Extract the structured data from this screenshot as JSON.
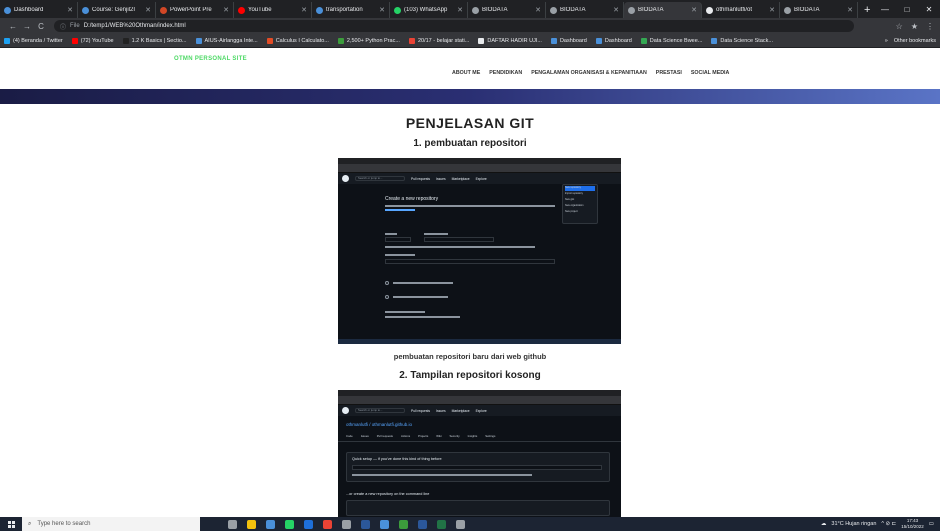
{
  "browser": {
    "tabs": [
      {
        "title": "Dashboard",
        "color": "#4a90d9"
      },
      {
        "title": "Course: Genjil2I",
        "color": "#4a90d9"
      },
      {
        "title": "PowerPoint Pre",
        "color": "#d24726"
      },
      {
        "title": "YouTube",
        "color": "#ff0000"
      },
      {
        "title": "transportation",
        "color": "#4a90d9"
      },
      {
        "title": "(103) WhatsApp",
        "color": "#25d366"
      },
      {
        "title": "BIODATA",
        "color": "#9aa0a6"
      },
      {
        "title": "BIODATA",
        "color": "#9aa0a6"
      },
      {
        "title": "BIODATA",
        "color": "#9aa0a6",
        "active": true
      },
      {
        "title": "othmanlutfi/ot",
        "color": "#e8eaed"
      },
      {
        "title": "BIODATA",
        "color": "#9aa0a6"
      }
    ],
    "new_tab": "+",
    "window_controls": [
      "—",
      "□",
      "✕"
    ],
    "nav": {
      "back": "←",
      "forward": "→",
      "reload": "C"
    },
    "url_info": "ⓘ",
    "url_scheme": "File",
    "url": "D:/temp1/WEB%20Othman/index.html",
    "addr_icons": [
      "☆",
      "★",
      "⋮"
    ],
    "bookmarks": [
      {
        "label": "(4) Beranda / Twitter",
        "color": "#1da1f2"
      },
      {
        "label": "(72) YouTube",
        "color": "#ff0000"
      },
      {
        "label": "1.2 K Basics | Sectio...",
        "color": "#222222"
      },
      {
        "label": "AIUS-Airlangga Inte...",
        "color": "#4a90d9"
      },
      {
        "label": "Calculus I Calculato...",
        "color": "#e34c26"
      },
      {
        "label": "2,500+ Python Prac...",
        "color": "#3c9c3c"
      },
      {
        "label": "20/17 - belajar stati...",
        "color": "#ea4335"
      },
      {
        "label": "DAFTAR HADIR UJI...",
        "color": "#e8eaed"
      },
      {
        "label": "Dashboard",
        "color": "#4a90d9"
      },
      {
        "label": "Dashboard",
        "color": "#4a90d9"
      },
      {
        "label": "Data Science Bwee...",
        "color": "#34a853"
      },
      {
        "label": "Data Science Stack...",
        "color": "#4a90d9"
      }
    ],
    "bookmarks_more": "»",
    "other_bookmarks": "Other bookmarks"
  },
  "site": {
    "brand": "OTMN PERSONAL SITE",
    "menu": [
      "ABOUT ME",
      "PENDIDIKAN",
      "PENGALAMAN ORGANISASI & KEPANITIAAN",
      "PRESTASI",
      "SOCIAL MEDIA"
    ],
    "colors": {
      "brand": "#4cd964",
      "banner_start": "#1a1c45",
      "banner_end": "#5a74c6"
    }
  },
  "content": {
    "heading": "PENJELASAN GIT",
    "section1_title": "1. pembuatan repositori",
    "section1_caption": "pembuatan repositori baru dari web github",
    "section2_title": "2. Tampilan repositori kosong",
    "shot1": {
      "search": "Search or jump to...",
      "nav": [
        "Pull requests",
        "Issues",
        "Marketplace",
        "Explore"
      ],
      "title": "Create a new repository",
      "dropdown": [
        "New repository",
        "Import repository",
        "New gist",
        "New organization",
        "New project"
      ]
    },
    "shot2": {
      "search": "Search or jump to...",
      "nav": [
        "Pull requests",
        "Issues",
        "Marketplace",
        "Explore"
      ],
      "repo": "othmanlutfi / othmanlutfi.github.io",
      "tabs": [
        "Code",
        "Issues",
        "Pull requests",
        "Actions",
        "Projects",
        "Wiki",
        "Security",
        "Insights",
        "Settings"
      ],
      "quick": "Quick setup — if you've done this kind of thing before",
      "cmd": "...or create a new repository on the command line"
    }
  },
  "taskbar": {
    "search_placeholder": "Type here to search",
    "apps": [
      "#9aa0a6",
      "#f4c20d",
      "#4a90d9",
      "#25d366",
      "#1e6fd9",
      "#ea4335",
      "#9aa0a6",
      "#2b579a",
      "#4a90d9",
      "#3c9c3c",
      "#2b579a",
      "#217346",
      "#9aa0a6"
    ],
    "weather": "31°C Hujan ringan",
    "tray_icons": "^ ⊘ ⊏",
    "time": "17:43",
    "date": "15/10/2022"
  }
}
